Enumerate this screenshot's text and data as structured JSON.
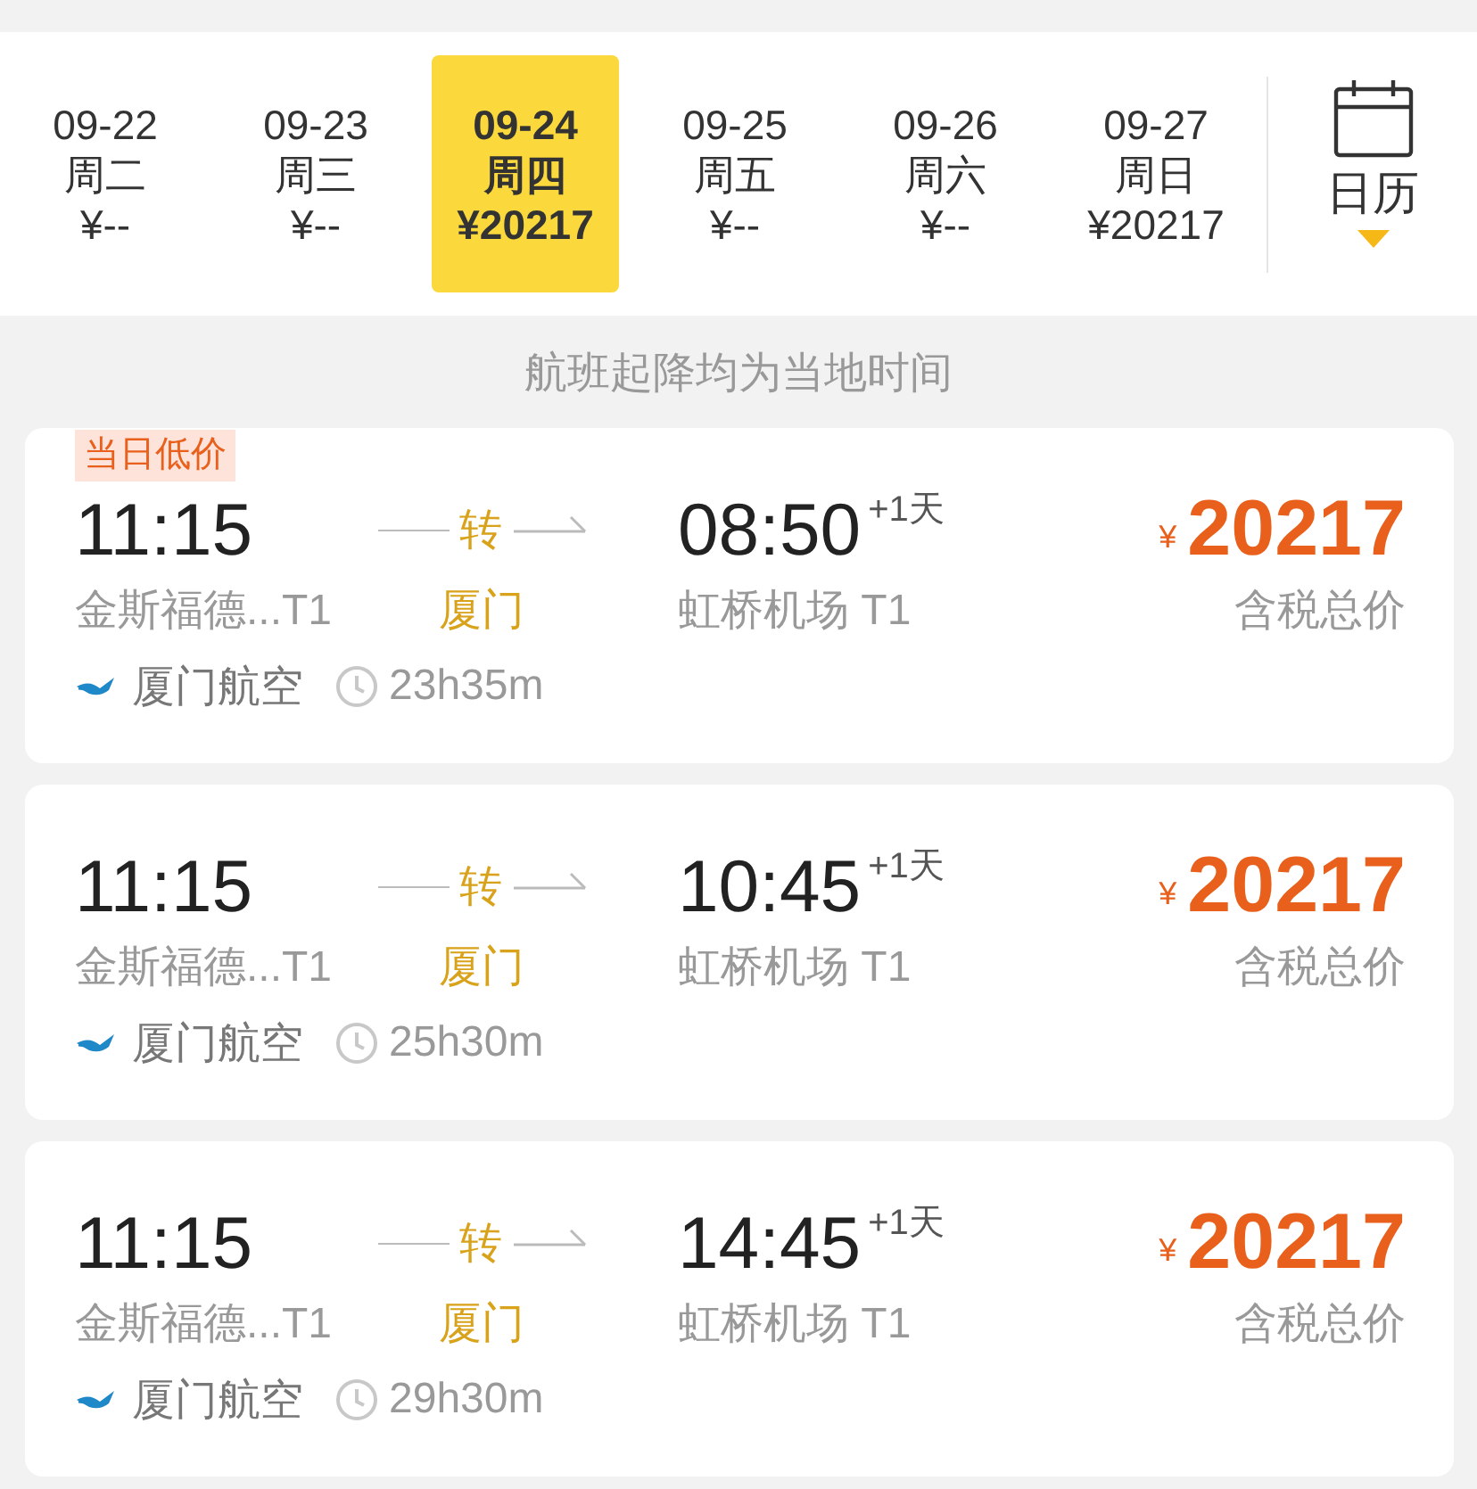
{
  "dates": [
    {
      "date": "09-22",
      "weekday": "周二",
      "price": "¥--",
      "selected": false
    },
    {
      "date": "09-23",
      "weekday": "周三",
      "price": "¥--",
      "selected": false
    },
    {
      "date": "09-24",
      "weekday": "周四",
      "price": "¥20217",
      "selected": true
    },
    {
      "date": "09-25",
      "weekday": "周五",
      "price": "¥--",
      "selected": false
    },
    {
      "date": "09-26",
      "weekday": "周六",
      "price": "¥--",
      "selected": false
    },
    {
      "date": "09-27",
      "weekday": "周日",
      "price": "¥20217",
      "selected": false
    }
  ],
  "calendar": {
    "label": "日历"
  },
  "notice": "航班起降均为当地时间",
  "flights": [
    {
      "badge": "当日低价",
      "depart_time": "11:15",
      "depart_airport": "金斯福德...T1",
      "transfer_label": "转",
      "transfer_city": "厦门",
      "arrive_time": "08:50",
      "day_offset": "+1天",
      "arrive_airport": "虹桥机场 T1",
      "airline": "厦门航空",
      "duration": "23h35m",
      "currency": "¥",
      "price": "20217",
      "price_note": "含税总价"
    },
    {
      "depart_time": "11:15",
      "depart_airport": "金斯福德...T1",
      "transfer_label": "转",
      "transfer_city": "厦门",
      "arrive_time": "10:45",
      "day_offset": "+1天",
      "arrive_airport": "虹桥机场 T1",
      "airline": "厦门航空",
      "duration": "25h30m",
      "currency": "¥",
      "price": "20217",
      "price_note": "含税总价"
    },
    {
      "depart_time": "11:15",
      "depart_airport": "金斯福德...T1",
      "transfer_label": "转",
      "transfer_city": "厦门",
      "arrive_time": "14:45",
      "day_offset": "+1天",
      "arrive_airport": "虹桥机场 T1",
      "airline": "厦门航空",
      "duration": "29h30m",
      "currency": "¥",
      "price": "20217",
      "price_note": "含税总价"
    }
  ]
}
